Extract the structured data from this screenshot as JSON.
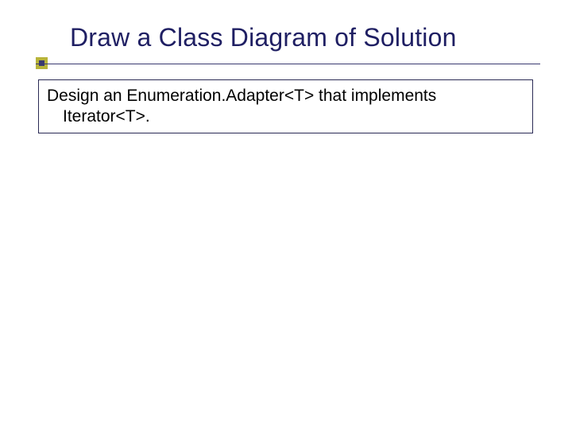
{
  "slide": {
    "title": "Draw a Class Diagram of Solution",
    "body_line1": "Design an Enumeration.Adapter<T> that implements",
    "body_line2": "Iterator<T>."
  }
}
